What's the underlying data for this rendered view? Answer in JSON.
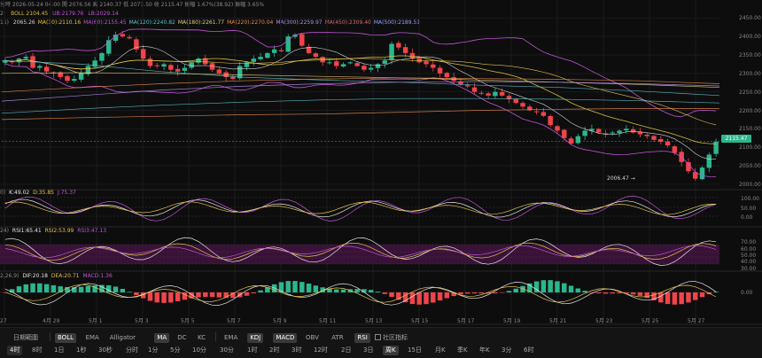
{
  "header": {
    "title_line": "分時  2026-05-24 04:00  開 2076.56  高 2140.37  低 2073.50  收 2115.47  振幅 1.67%(38.92)  振幅 3.65%",
    "boll_prefix": "2)",
    "boll_label": "BOLL 2104.45",
    "boll_ub": "UB:2179.76",
    "boll_lb": "LB:2029.14",
    "ma_prefix": "15)",
    "ma_items": [
      {
        "text": "2065.26",
        "color": "#d4d4d4"
      },
      {
        "text": "MA(30):2110.16",
        "color": "#e6c34a"
      },
      {
        "text": "MA(60):2155.45",
        "color": "#c355d6"
      },
      {
        "text": "MA(120):2240.82",
        "color": "#5cc1c8"
      },
      {
        "text": "MA(180):2261.77",
        "color": "#e0d07a"
      },
      {
        "text": "MA(220):2270.04",
        "color": "#e68a4a"
      },
      {
        "text": "MA(300):2259.97",
        "color": "#b38de6"
      },
      {
        "text": "MA(450):2309.40",
        "color": "#d66a6a"
      },
      {
        "text": "MA(500):2189.51",
        "color": "#9aa0ff"
      }
    ]
  },
  "price_axis": [
    "2450.00",
    "2400.00",
    "2350.00",
    "2300.00",
    "2250.00",
    "2200.00",
    "2150.00",
    "2100.00",
    "2050.00",
    "2000.00"
  ],
  "current_price": "2115.47",
  "low_marker": "2006.47 →",
  "kdj": {
    "label": "0)",
    "k": "K:49.02",
    "d": "D:35.85",
    "j": "J:75.37",
    "axis": [
      "100.00",
      "50.00",
      "0.00"
    ]
  },
  "rsi": {
    "label": "24)",
    "rsi1": "RSI1:65.41",
    "rsi2": "RSI2:53.99",
    "rsi3": "RSI3:47.13",
    "axis": [
      "70.00",
      "60.00",
      "50.00",
      "40.00",
      "30.00"
    ]
  },
  "macd": {
    "label": "2,26,9)",
    "dif": "DIF:20.18",
    "dea": "DEA:20.71",
    "macd": "MACD:1.36",
    "axis": [
      "0.00"
    ]
  },
  "x_axis": [
    "27",
    "4月 29",
    "5月 1",
    "5月 3",
    "5月 5",
    "5月 7",
    "5月 9",
    "5月 11",
    "5月 13",
    "5月 15",
    "5月 17",
    "5月 19",
    "5月 21",
    "5月 23",
    "5月 25",
    "5月 27"
  ],
  "axis_right": {
    "a": "对数",
    "b": "%",
    "c": "自动"
  },
  "toolbar_row1": {
    "range": "日期範圍",
    "indicators_left": [
      "BOLL",
      "EMA",
      "Alligator",
      "MA",
      "DC",
      "KC"
    ],
    "indicators_right": [
      "EMA",
      "KDJ",
      "MACD",
      "OBV",
      "ATR",
      "RSI"
    ],
    "community": "社区指标"
  },
  "toolbar_row2": [
    "4时",
    "8时",
    "1日",
    "1秒",
    "30秒",
    "分时",
    "1分",
    "5分",
    "10分",
    "30分",
    "1时",
    "2时",
    "3时",
    "12时",
    "2日",
    "3日",
    "周K",
    "15日",
    "月K",
    "季K",
    "年K",
    "3分",
    "6时"
  ],
  "colors": {
    "up": "#2bb78e",
    "down": "#f0444a",
    "boll_mid": "#d4c03a",
    "boll_band": "#c355d6",
    "ma120": "#5cc1c8",
    "rsi_band": "#3a1238",
    "accent": "#2bb78e"
  },
  "chart_data": {
    "type": "candlestick",
    "x_label_dates": [
      "4月 29",
      "5月 1",
      "5月 3",
      "5月 5",
      "5月 7",
      "5月 9",
      "5月 11",
      "5月 13",
      "5月 15",
      "5月 17",
      "5月 19",
      "5月 21",
      "5月 23"
    ],
    "ylim": [
      1990,
      2470
    ],
    "close_path": [
      2335,
      2330,
      2340,
      2345,
      2315,
      2320,
      2305,
      2300,
      2290,
      2280,
      2285,
      2300,
      2320,
      2335,
      2355,
      2390,
      2405,
      2400,
      2395,
      2365,
      2340,
      2320,
      2320,
      2325,
      2310,
      2305,
      2315,
      2330,
      2340,
      2325,
      2310,
      2300,
      2290,
      2285,
      2320,
      2330,
      2340,
      2345,
      2355,
      2365,
      2360,
      2400,
      2405,
      2375,
      2355,
      2345,
      2330,
      2330,
      2320,
      2325,
      2330,
      2320,
      2310,
      2315,
      2325,
      2335,
      2380,
      2370,
      2355,
      2340,
      2330,
      2325,
      2315,
      2300,
      2290,
      2280,
      2270,
      2265,
      2250,
      2245,
      2240,
      2250,
      2240,
      2230,
      2220,
      2210,
      2200,
      2195,
      2185,
      2160,
      2145,
      2125,
      2110,
      2130,
      2145,
      2150,
      2140,
      2135,
      2140,
      2145,
      2150,
      2140,
      2135,
      2130,
      2120,
      2115,
      2105,
      2085,
      2060,
      2035,
      2015,
      2045,
      2080,
      2115
    ]
  }
}
